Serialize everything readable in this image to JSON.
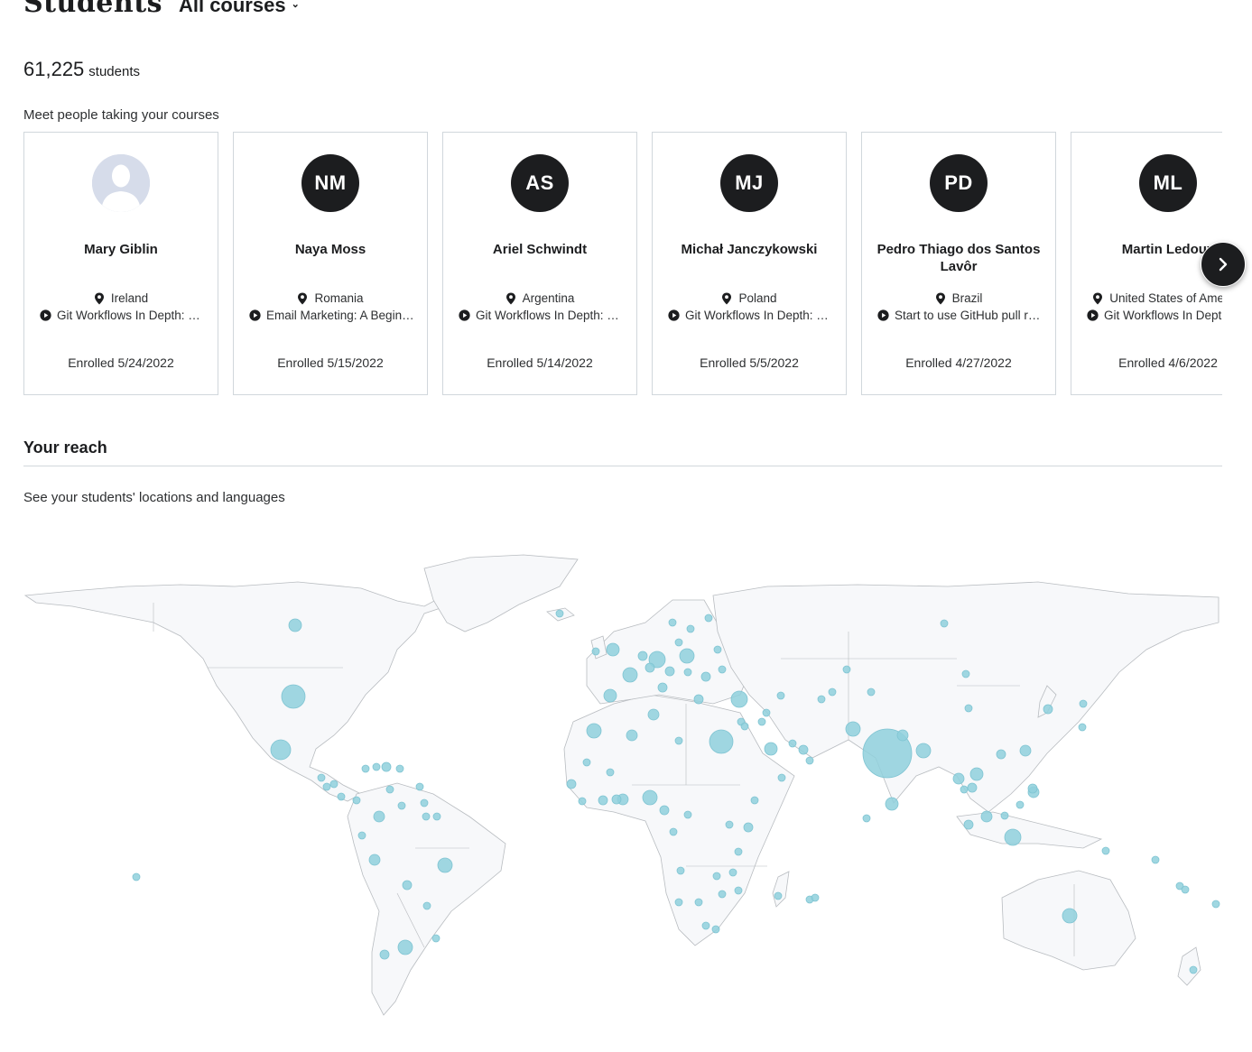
{
  "header": {
    "title": "Students",
    "course_filter": "All courses"
  },
  "stats": {
    "count": "61,225",
    "label": "students"
  },
  "meet_heading": "Meet people taking your courses",
  "students": [
    {
      "initials": "",
      "name": "Mary Giblin",
      "country": "Ireland",
      "course": "Git Workflows In Depth: Learn To Use Git Like a Pro",
      "enrolled": "Enrolled 5/24/2022"
    },
    {
      "initials": "NM",
      "name": "Naya Moss",
      "country": "Romania",
      "course": "Email Marketing: A Beginner's Guide",
      "enrolled": "Enrolled 5/15/2022"
    },
    {
      "initials": "AS",
      "name": "Ariel Schwindt",
      "country": "Argentina",
      "course": "Git Workflows In Depth: Learn To Use Git Like a Pro",
      "enrolled": "Enrolled 5/14/2022"
    },
    {
      "initials": "MJ",
      "name": "Michał Janczykowski",
      "country": "Poland",
      "course": "Git Workflows In Depth: Learn To Use Git Like a Pro",
      "enrolled": "Enrolled 5/5/2022"
    },
    {
      "initials": "PD",
      "name": "Pedro Thiago dos Santos Lavôr",
      "country": "Brazil",
      "course": "Start to use GitHub pull requests",
      "enrolled": "Enrolled 4/27/2022"
    },
    {
      "initials": "ML",
      "name": "Martin Ledoux",
      "country": "United States of America",
      "course": "Git Workflows In Depth: Learn To Use Git Like a Pro",
      "enrolled": "Enrolled 4/6/2022"
    }
  ],
  "reach": {
    "title": "Your reach",
    "subtitle": "See your students' locations and languages"
  },
  "colors": {
    "bubble": "#8fd0dc",
    "land": "#f7f8fa",
    "border": "#b8bcc0",
    "dark": "#1c1d1f"
  },
  "map_markers": [
    {
      "country": "India",
      "relative_size": 1.0
    },
    {
      "country": "United States",
      "relative_size": 0.45
    },
    {
      "country": "Egypt",
      "relative_size": 0.45
    },
    {
      "country": "Mexico",
      "relative_size": 0.4
    },
    {
      "country": "Germany",
      "relative_size": 0.35
    },
    {
      "country": "Turkey",
      "relative_size": 0.35
    },
    {
      "country": "Nigeria",
      "relative_size": 0.32
    },
    {
      "country": "Indonesia",
      "relative_size": 0.33
    },
    {
      "country": "Brazil",
      "relative_size": 0.3
    },
    {
      "country": "Pakistan",
      "relative_size": 0.33
    },
    {
      "country": "Bangladesh",
      "relative_size": 0.3
    },
    {
      "country": "Australia",
      "relative_size": 0.3
    },
    {
      "country": "Argentina",
      "relative_size": 0.3
    }
  ]
}
